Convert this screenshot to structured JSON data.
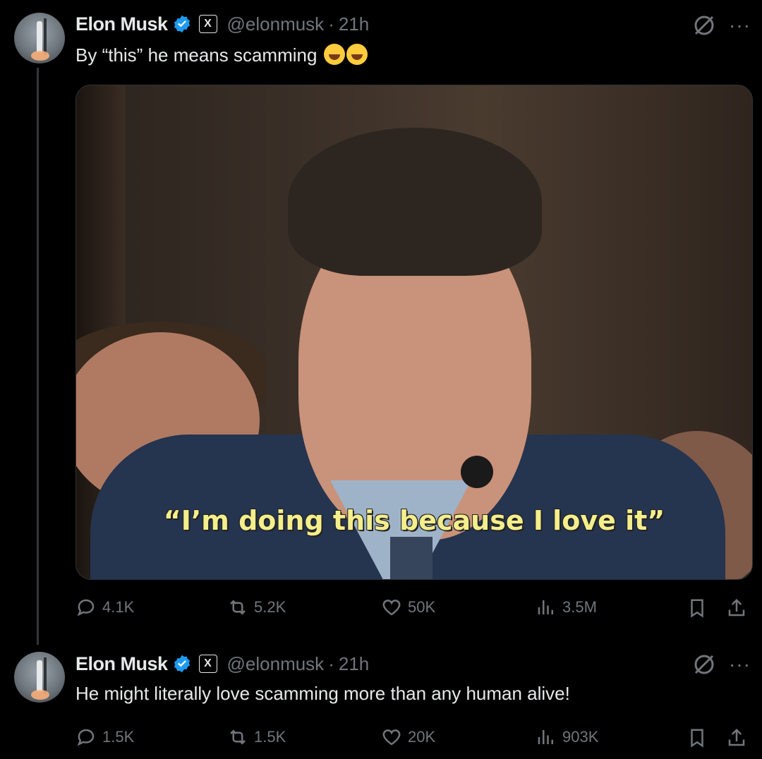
{
  "tweets": [
    {
      "name": "Elon Musk",
      "handle": "@elonmusk",
      "time": "21h",
      "text": "By “this” he means scamming",
      "media_caption": "“I’m doing this because I love it”",
      "stats": {
        "replies": "4.1K",
        "reposts": "5.2K",
        "likes": "50K",
        "views": "3.5M"
      }
    },
    {
      "name": "Elon Musk",
      "handle": "@elonmusk",
      "time": "21h",
      "text": "He might literally love scamming more than any human alive!",
      "stats": {
        "replies": "1.5K",
        "reposts": "1.5K",
        "likes": "20K",
        "views": "903K"
      }
    }
  ],
  "icons": {
    "verified": "verified-badge",
    "affiliate": "x-logo-badge",
    "grok": "grok-icon",
    "more": "more-icon",
    "reply": "reply-icon",
    "repost": "repost-icon",
    "like": "like-icon",
    "views": "views-icon",
    "bookmark": "bookmark-icon",
    "share": "share-icon"
  },
  "colors": {
    "background": "#000000",
    "text": "#e7e9ea",
    "muted": "#71767b",
    "verified": "#1d9bf0",
    "caption": "#f4ee8c"
  },
  "badge_label": "X",
  "more_label": "···",
  "dot_separator": "·"
}
